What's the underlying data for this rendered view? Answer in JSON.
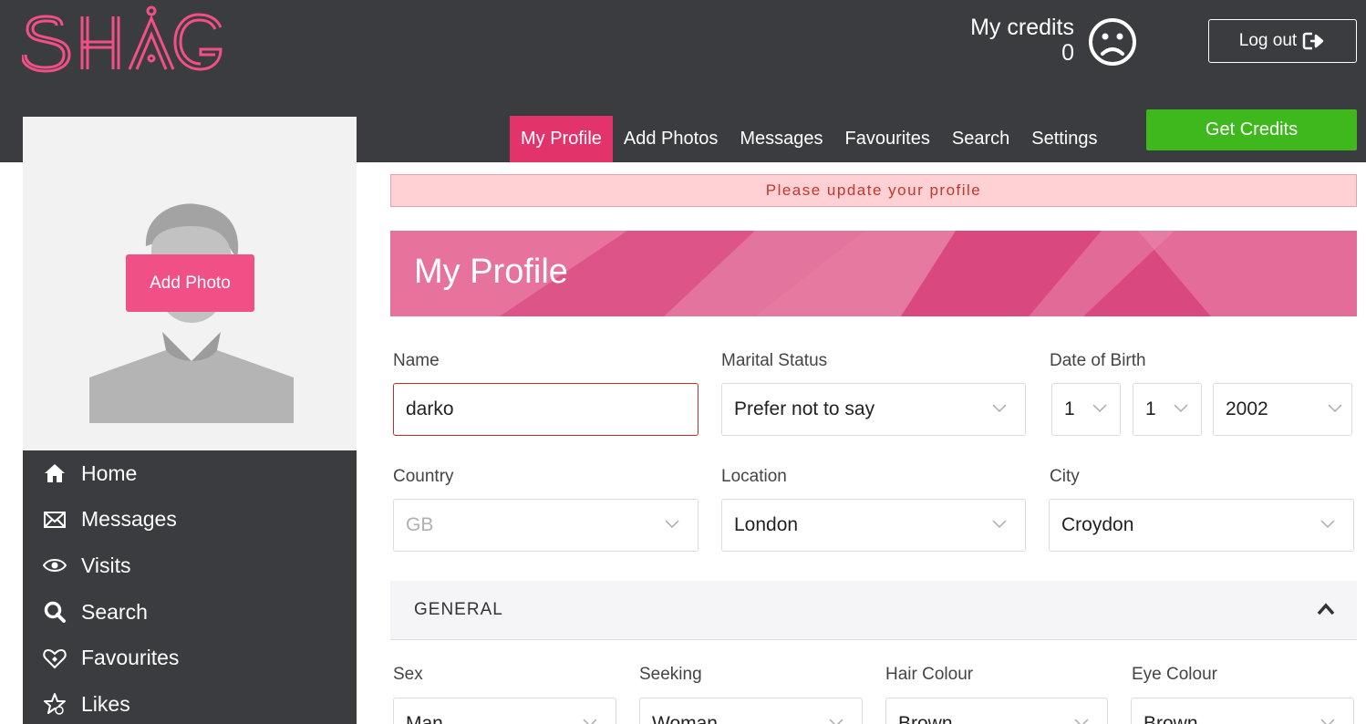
{
  "header": {
    "logo_text": "SHAG",
    "credits_label": "My credits",
    "credits_value": "0",
    "logout_label": "Log out",
    "get_credits_label": "Get Credits"
  },
  "topnav": {
    "tabs": [
      "My Profile",
      "Add Photos",
      "Messages",
      "Favourites",
      "Search",
      "Settings"
    ]
  },
  "sidebar": {
    "add_photo_label": "Add Photo",
    "items": [
      "Home",
      "Messages",
      "Visits",
      "Search",
      "Favourites",
      "Likes"
    ]
  },
  "alert_text": "Please update your profile",
  "page_title": "My Profile",
  "form": {
    "name_label": "Name",
    "name_value": "darko",
    "marital_label": "Marital Status",
    "marital_value": "Prefer not to say",
    "dob_label": "Date of Birth",
    "dob_day": "1",
    "dob_month": "1",
    "dob_year": "2002",
    "country_label": "Country",
    "country_value": "GB",
    "location_label": "Location",
    "location_value": "London",
    "city_label": "City",
    "city_value": "Croydon"
  },
  "general": {
    "title": "GENERAL",
    "sex_label": "Sex",
    "sex_value": "Man",
    "seeking_label": "Seeking",
    "seeking_value": "Woman",
    "hair_label": "Hair Colour",
    "hair_value": "Brown",
    "eye_label": "Eye Colour",
    "eye_value": "Brown"
  },
  "colors": {
    "brand_pink": "#e2336b",
    "header_bg": "#3b3c40",
    "credits_green": "#3fb81e"
  }
}
